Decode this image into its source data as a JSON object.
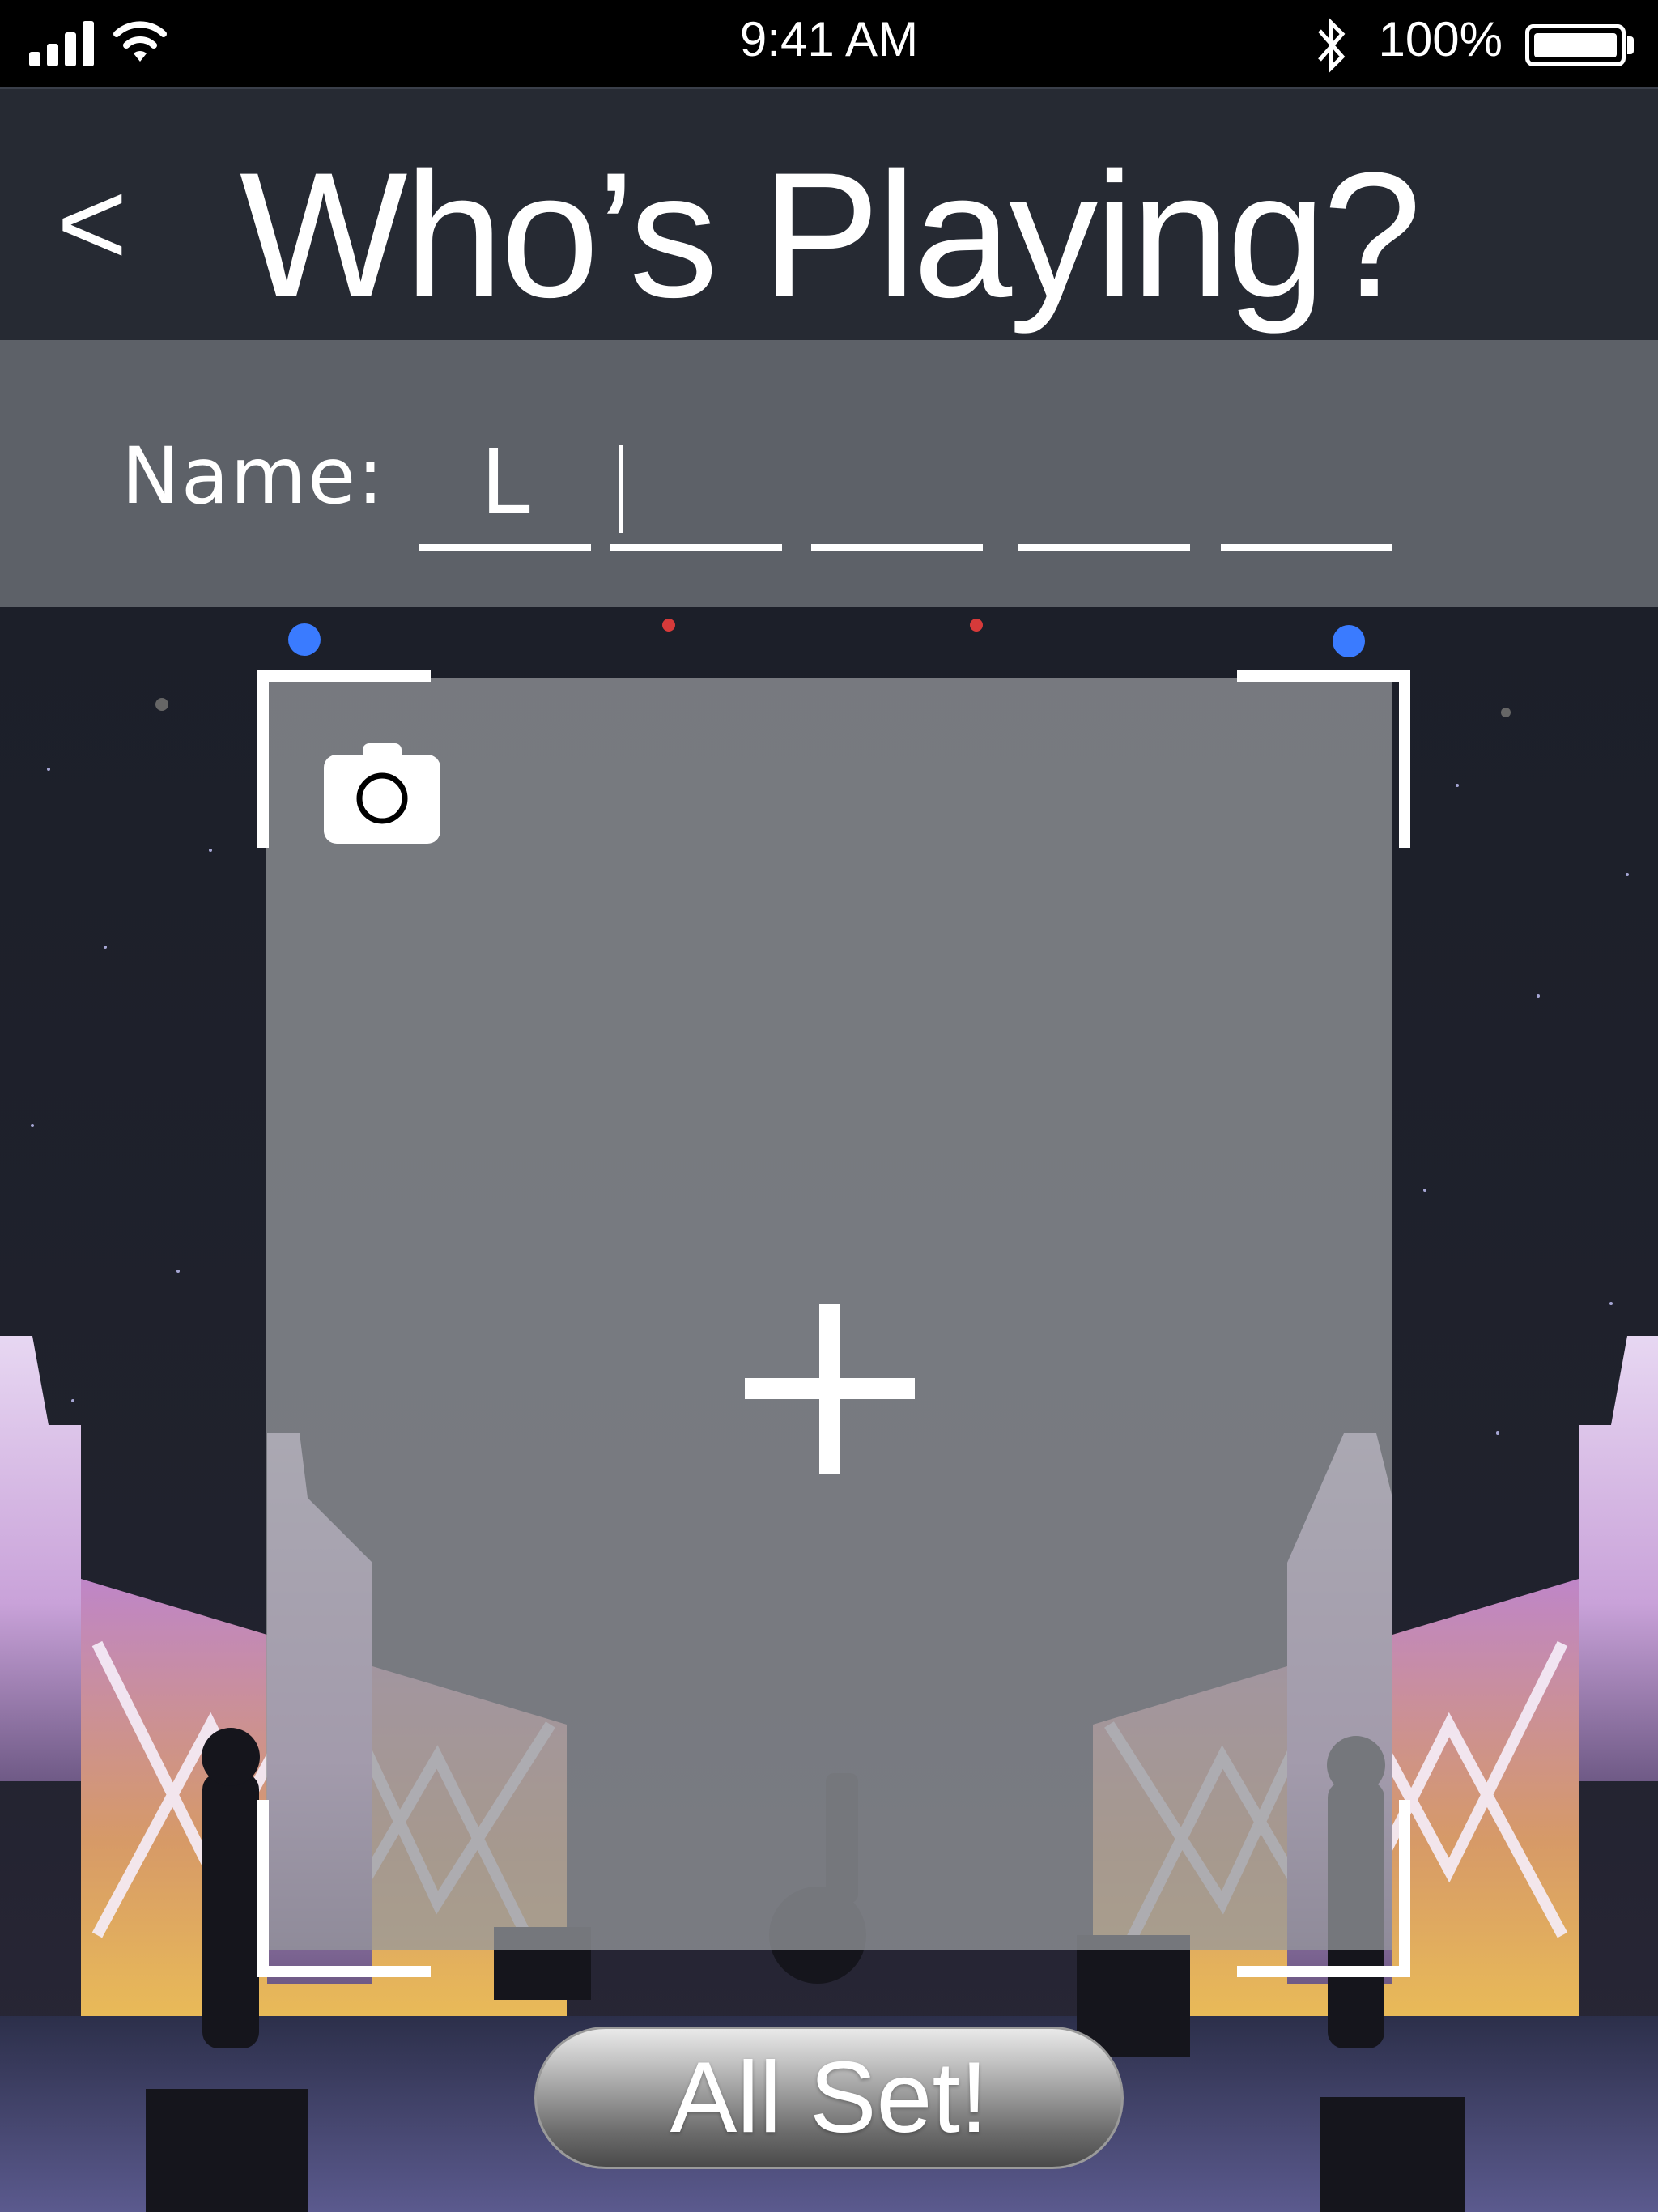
{
  "status_bar": {
    "time": "9:41 AM",
    "battery_percent": "100%",
    "icons": [
      "signal-icon",
      "wifi-icon",
      "bluetooth-icon",
      "battery-icon"
    ]
  },
  "header": {
    "back_label": "<",
    "title": "Who’s Playing?"
  },
  "name_entry": {
    "label": "Name:",
    "letters": [
      "L",
      "",
      "",
      "",
      ""
    ],
    "active_slot": 1
  },
  "photo": {
    "camera_icon": "camera-icon",
    "add_icon": "plus-icon"
  },
  "actions": {
    "all_set_label": "All Set!"
  },
  "colors": {
    "header_bg": "#262a33",
    "name_bar_bg": "#5d6168",
    "text": "#ffffff"
  }
}
